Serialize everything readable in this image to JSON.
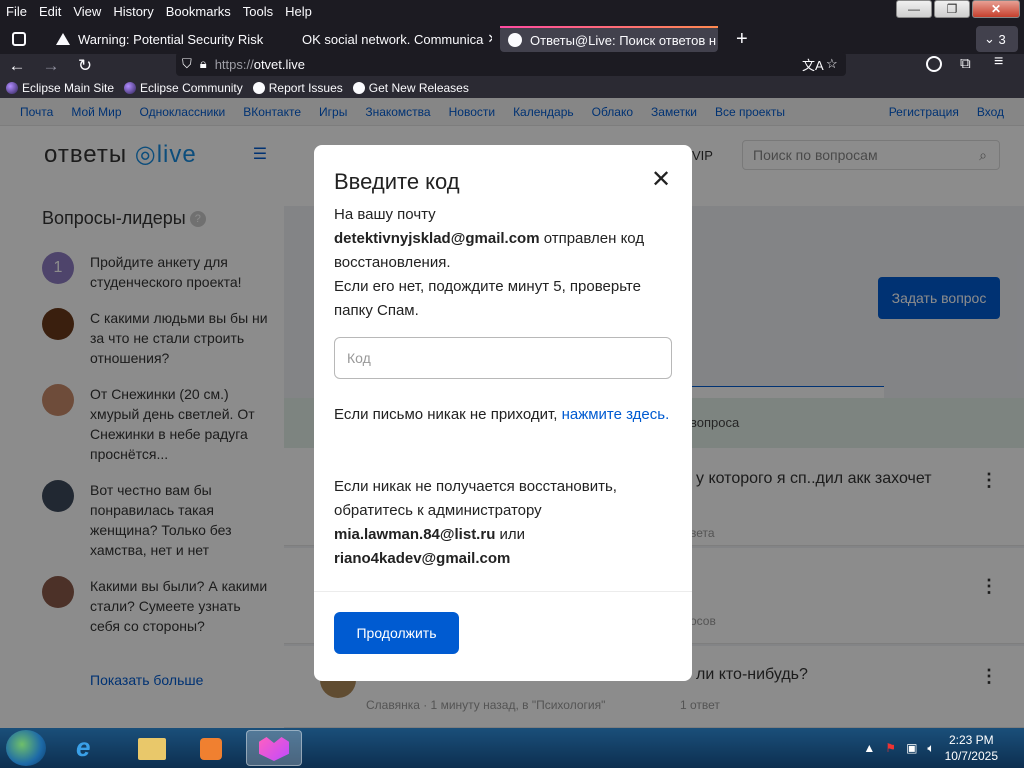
{
  "menu": [
    "File",
    "Edit",
    "View",
    "History",
    "Bookmarks",
    "Tools",
    "Help"
  ],
  "window_controls": {
    "minimize": "—",
    "maximize": "❐",
    "close": "✕"
  },
  "tabs": [
    {
      "label": "Warning: Potential Security Risk"
    },
    {
      "label": "OK social network. Communica"
    },
    {
      "label": "Ответы@Live: Поиск ответов н"
    }
  ],
  "tab_overflow_count": "3",
  "url": {
    "scheme": "https://",
    "host": "otvet.live"
  },
  "bookmarks": [
    "Eclipse Main Site",
    "Eclipse Community",
    "Report Issues",
    "Get New Releases"
  ],
  "site_nav": {
    "left": [
      "Почта",
      "Мой Мир",
      "Одноклассники",
      "ВКонтакте",
      "Игры",
      "Знакомства",
      "Новости",
      "Календарь",
      "Облако",
      "Заметки",
      "Все проекты"
    ],
    "right": [
      "Регистрация",
      "Вход"
    ]
  },
  "header": {
    "logo_text": "ответы",
    "logo_live": "live",
    "vip": "VIP",
    "search_placeholder": "Поиск по вопросам"
  },
  "sidebar": {
    "title": "Вопросы-лидеры",
    "questions": [
      {
        "text": "Пройдите анкету для студенческого проекта!",
        "avatar": "1"
      },
      {
        "text": "С какими людьми вы бы ни за что не стали строить отношения?"
      },
      {
        "text": "От Снежинки (20 см.) хмурый день светлей. От Снежинки в небе радуга проснётся..."
      },
      {
        "text": "Вот честно вам бы понравилась такая женщина? Только без хамства, нет и нет"
      },
      {
        "text": "Какими вы были? А какими стали? Сумеете узнать себя со стороны?"
      }
    ],
    "show_more": "Показать больше"
  },
  "main": {
    "ask_button": "Задать вопрос",
    "green_row_text": "вопроса",
    "feed": [
      {
        "title": "у которого я сп..дил акк захочет",
        "meta": "вета"
      },
      {
        "title": "",
        "meta": "осов"
      },
      {
        "title": "ли кто-нибудь?",
        "meta": "Славянка · 1 минуту назад, в \"Психология\"",
        "answers": "1 ответ"
      }
    ]
  },
  "modal": {
    "title": "Введите код",
    "line1": "На вашу почту",
    "email": "detektivnyjsklad@gmail.com",
    "line2": " отправлен код восстановления.",
    "line3": "Если его нет, подождите минут 5, проверьте папку Спам.",
    "code_placeholder": "Код",
    "no_letter_text": "Если письмо никак не приходит, ",
    "no_letter_link": "нажмите здесь.",
    "admin_text": "Если никак не получается восстановить, обратитесь к администратору",
    "admin_email1": "mia.lawman.84@list.ru",
    "or": " или ",
    "admin_email2": "riano4kadev@gmail.com",
    "continue": "Продолжить"
  },
  "taskbar": {
    "time": "2:23 PM",
    "date": "10/7/2025"
  }
}
